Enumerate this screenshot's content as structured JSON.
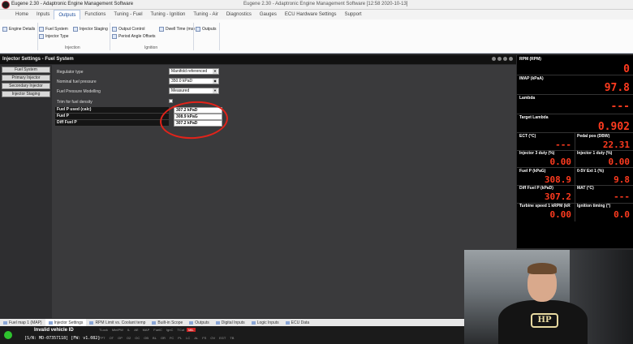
{
  "window": {
    "title_left": "Eugene 2.30 - Adaptronic Engine Management Software",
    "title_center": "Eugene 2.30 - Adaptronic Engine Management Software  [12:58  2020-10-13]"
  },
  "menu": {
    "tabs": [
      "Home",
      "Inputs",
      "Outputs",
      "Functions",
      "Tuning - Fuel",
      "Tuning - Ignition",
      "Tuning - Air",
      "Diagnostics",
      "Gauges",
      "ECU Hardware Settings",
      "Support"
    ],
    "active": "Outputs"
  },
  "ribbon": {
    "engine_details": "Engine Details",
    "fuel_system": "Fuel System",
    "injector_type": "Injector Type",
    "injector_staging": "Injector Staging",
    "output_control": "Output Control",
    "period_angle_offsets": "Period Angle Offsets",
    "dwell_time": "Dwell Time (ms)",
    "outputs": "Outputs",
    "group_injection": "Injection",
    "group_ignition": "Ignition"
  },
  "settings": {
    "header": "Injector Settings - Fuel System",
    "nav": [
      "Fuel System",
      "Primary Injector",
      "Secondary Injector",
      "Injector Staging"
    ],
    "fields": {
      "regulator_label": "Regulator type",
      "regulator_value": "Manifold referenced",
      "nominal_label": "Nominal fuel pressure",
      "nominal_value": "350.0 kPaD",
      "modelling_label": "Fuel Pressure Modelling",
      "modelling_value": "Measured",
      "trim_label": "Trim for fuel density"
    },
    "table": [
      {
        "label": "Fuel P used (calc)",
        "value": "307.2 kPaD"
      },
      {
        "label": "Fuel P",
        "value": "308.9 kPaG"
      },
      {
        "label": "Diff Fuel P",
        "value": "307.2 kPaD"
      }
    ]
  },
  "gauges": {
    "rpm": {
      "label": "RPM (RPM)",
      "value": "0"
    },
    "imap": {
      "label": "IMAP (kPaA)",
      "value": "97.8"
    },
    "lambda": {
      "label": "Lambda",
      "value": "---"
    },
    "target_lambda": {
      "label": "Target Lambda",
      "value": "0.902"
    },
    "ect": {
      "label": "ECT (°C)",
      "value": "---"
    },
    "pedal": {
      "label": "Pedal pos (DBW)",
      "value": "22.31"
    },
    "inj3": {
      "label": "Injector 3 duty (%)",
      "value": "0.00"
    },
    "inj1": {
      "label": "Injector 1 duty (%)",
      "value": "0.00"
    },
    "fuelp": {
      "label": "Fuel P (kPaG)",
      "value": "308.9"
    },
    "ext1": {
      "label": "0-5V Ext 1 (%)",
      "value": "9.8"
    },
    "difffuel": {
      "label": "Diff Fuel P (kPaD)",
      "value": "307.2"
    },
    "mat": {
      "label": "MAT (°C)",
      "value": "---"
    },
    "turbine": {
      "label": "Turbine speed 1 kRPM (kR",
      "value": "0.00"
    },
    "ign": {
      "label": "Ignition timing (°)",
      "value": "0.0"
    }
  },
  "bottom_tabs": [
    "Fuel map 1 (MAP)",
    "Injector Settings",
    "RPM Limit vs. Coolant temp",
    "Built-in Scope",
    "Outputs",
    "Digital Inputs",
    "Logic Inputs",
    "ECU Data"
  ],
  "bottom_active": "Injector Settings",
  "status": {
    "vehicle": "Invalid vehicle ID",
    "serial": "[S/N: MD-07357118] [FW: v1.082]",
    "flags_top": [
      "TLock",
      "MinIPW",
      "IL",
      "AE",
      "MAP",
      "FuelC",
      "IgnC",
      "TCut",
      "MIL"
    ],
    "flags_bottom": [
      "FPT",
      "OT",
      "OP",
      "O2",
      "OC",
      "OB",
      "BL",
      "OR",
      "FC",
      "PL",
      "LC",
      "AL",
      "FS",
      "OV",
      "EGT",
      "TB"
    ]
  },
  "webcam": {
    "shirt_text": "HP"
  }
}
